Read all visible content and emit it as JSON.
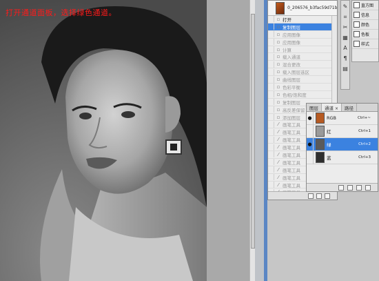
{
  "annotation": "打开通道面板，选择绿色通道。",
  "history": {
    "snapshot_label": "0_206576_b3fac59d71b...",
    "items": [
      {
        "label": "打开",
        "state": "first"
      },
      {
        "label": "复制图层",
        "state": "active"
      },
      {
        "label": "应用图像",
        "state": "dim"
      },
      {
        "label": "应用图像",
        "state": "dim"
      },
      {
        "label": "计算",
        "state": "dim"
      },
      {
        "label": "载入通道",
        "state": "dim"
      },
      {
        "label": "混合更改",
        "state": "dim"
      },
      {
        "label": "载入图层选区",
        "state": "dim"
      },
      {
        "label": "曲线图层",
        "state": "dim"
      },
      {
        "label": "色彩平衡",
        "state": "dim"
      },
      {
        "label": "色相/饱和度",
        "state": "dim"
      },
      {
        "label": "复制图层",
        "state": "dim"
      },
      {
        "label": "高反差保留",
        "state": "dim"
      },
      {
        "label": "添加图层",
        "state": "dim"
      },
      {
        "label": "画笔工具",
        "state": "dim"
      },
      {
        "label": "画笔工具",
        "state": "dim"
      },
      {
        "label": "画笔工具",
        "state": "dim"
      },
      {
        "label": "画笔工具",
        "state": "dim"
      },
      {
        "label": "画笔工具",
        "state": "dim"
      },
      {
        "label": "画笔工具",
        "state": "dim"
      },
      {
        "label": "画笔工具",
        "state": "dim"
      },
      {
        "label": "画笔工具",
        "state": "dim"
      },
      {
        "label": "画笔工具",
        "state": "dim"
      },
      {
        "label": "画笔工具",
        "state": "dim"
      },
      {
        "label": "画笔工具",
        "state": "dim"
      },
      {
        "label": "画笔工具",
        "state": "dim"
      }
    ]
  },
  "dock": {
    "items": [
      {
        "label": "直方图",
        "icon": "histogram-icon"
      },
      {
        "label": "信息",
        "icon": "info-icon"
      },
      {
        "label": "颜色",
        "icon": "color-icon"
      },
      {
        "label": "色板",
        "icon": "swatches-icon"
      },
      {
        "label": "样式",
        "icon": "styles-icon"
      }
    ]
  },
  "channels": {
    "tabs": [
      {
        "label": "图层"
      },
      {
        "label": "通道",
        "active": true
      },
      {
        "label": "路径"
      }
    ],
    "tab_close": "×",
    "rows": [
      {
        "name": "RGB",
        "shortcut": "Ctrl+~",
        "visible": true,
        "thumb": "#b65a22",
        "active": false
      },
      {
        "name": "红",
        "shortcut": "Ctrl+1",
        "visible": false,
        "thumb": "#9a9a9a",
        "active": false
      },
      {
        "name": "绿",
        "shortcut": "Ctrl+2",
        "visible": true,
        "thumb": "#5a5a5a",
        "active": true
      },
      {
        "name": "蓝",
        "shortcut": "Ctrl+3",
        "visible": false,
        "thumb": "#2e2e2e",
        "active": false
      }
    ]
  },
  "colors": {
    "annotation": "#ff1a1a",
    "selection": "#3b82e0"
  }
}
